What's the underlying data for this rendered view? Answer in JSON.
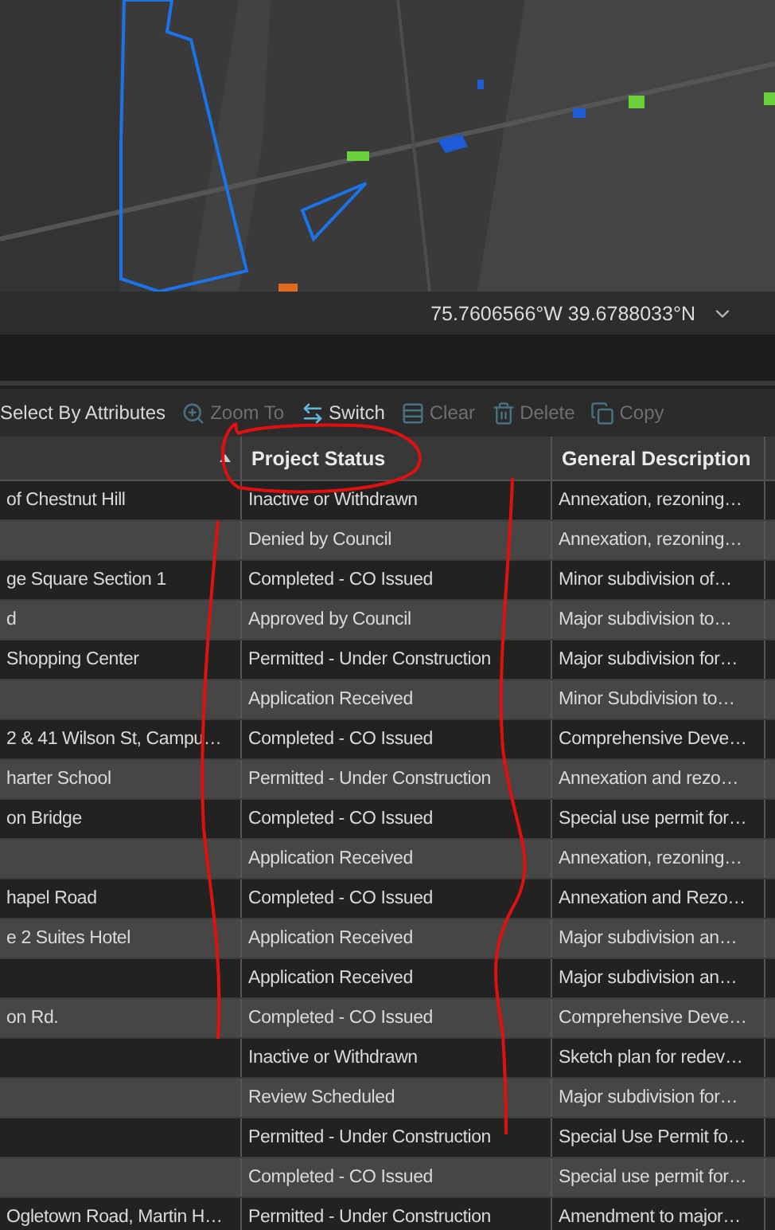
{
  "status_bar": {
    "coordinates": "75.7606566°W 39.6788033°N"
  },
  "toolbar": [
    {
      "label": "Select By Attributes",
      "disabled": false
    },
    {
      "label": "Zoom To",
      "disabled": true
    },
    {
      "label": "Switch",
      "disabled": false
    },
    {
      "label": "Clear",
      "disabled": true
    },
    {
      "label": "Delete",
      "disabled": true
    },
    {
      "label": "Copy",
      "disabled": true
    }
  ],
  "table": {
    "columns": [
      {
        "sorted": true
      },
      {
        "label": "Project Status",
        "sorted": false
      },
      {
        "label": "General Description",
        "sorted": false
      }
    ],
    "rows": [
      {
        "column_1": "of Chestnut Hill",
        "project_status": "Inactive or Withdrawn",
        "general_description": "Annexation, rezoning…"
      },
      {
        "project_status": "Denied by Council",
        "general_description": "Annexation, rezoning…"
      },
      {
        "column_1": "ge Square Section 1",
        "project_status": "Completed - CO Issued",
        "general_description": "Minor subdivision of…"
      },
      {
        "column_1": "d",
        "project_status": "Approved by Council",
        "general_description": "Major subdivision to…"
      },
      {
        "column_1": "Shopping Center",
        "project_status": "Permitted - Under Construction",
        "general_description": "Major subdivision for…"
      },
      {
        "project_status": "Application Received",
        "general_description": "Minor Subdivision to…"
      },
      {
        "column_1": "2 & 41 Wilson St, Campu…",
        "project_status": "Completed - CO Issued",
        "general_description": "Comprehensive Deve…"
      },
      {
        "column_1": "harter School",
        "project_status": "Permitted - Under Construction",
        "general_description": "Annexation and rezo…"
      },
      {
        "column_1": "on Bridge",
        "project_status": "Completed - CO Issued",
        "general_description": "Special use permit for…"
      },
      {
        "project_status": "Application Received",
        "general_description": "Annexation, rezoning…"
      },
      {
        "column_1": "hapel Road",
        "project_status": "Completed - CO Issued",
        "general_description": "Annexation and Rezo…"
      },
      {
        "column_1": "e 2 Suites Hotel",
        "project_status": "Application Received",
        "general_description": "Major subdivision an…"
      },
      {
        "project_status": "Application Received",
        "general_description": "Major subdivision an…"
      },
      {
        "column_1": "on Rd.",
        "project_status": "Completed - CO Issued",
        "general_description": "Comprehensive Deve…"
      },
      {
        "project_status": "Inactive or Withdrawn",
        "general_description": "Sketch plan for redev…"
      },
      {
        "project_status": "Review Scheduled",
        "general_description": "Major subdivision for…"
      },
      {
        "project_status": "Permitted - Under Construction",
        "general_description": "Special Use Permit fo…"
      },
      {
        "project_status": "Completed - CO Issued",
        "general_description": "Special use permit for…"
      },
      {
        "column_1": "Ogletown Road, Martin H…",
        "project_status": "Permitted - Under Construction",
        "general_description": "Amendment to major…"
      }
    ]
  }
}
